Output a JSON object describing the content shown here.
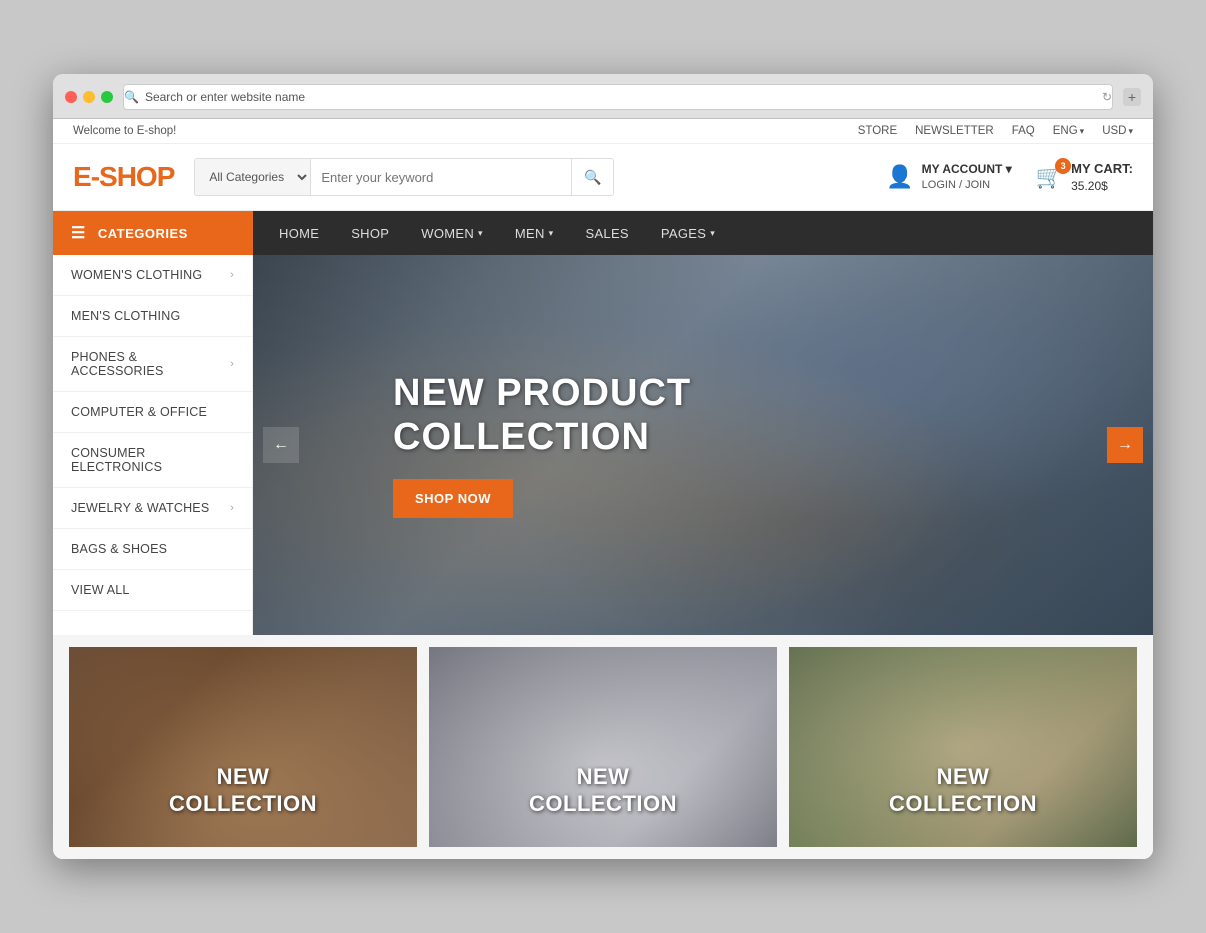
{
  "browser": {
    "address": "Search or enter website name"
  },
  "topbar": {
    "welcome": "Welcome to E-shop!",
    "links": [
      "STORE",
      "NEWSLETTER",
      "FAQ"
    ],
    "lang": "ENG",
    "currency": "USD"
  },
  "header": {
    "logo_prefix": "E",
    "logo_suffix": "-SHOP",
    "search_placeholder": "Enter your keyword",
    "search_category": "All Categories",
    "account_label": "MY ACCOUNT",
    "account_sub": "LOGIN / JOIN",
    "cart_label": "MY CART:",
    "cart_amount": "35.20$",
    "cart_count": "3"
  },
  "navbar": {
    "categories_label": "CATEGORIES",
    "links": [
      {
        "label": "HOME",
        "has_arrow": false
      },
      {
        "label": "SHOP",
        "has_arrow": false
      },
      {
        "label": "WOMEN",
        "has_arrow": true
      },
      {
        "label": "MEN",
        "has_arrow": true
      },
      {
        "label": "SALES",
        "has_arrow": false
      },
      {
        "label": "PAGES",
        "has_arrow": true
      }
    ]
  },
  "sidebar": {
    "items": [
      {
        "label": "WOMEN'S CLOTHING",
        "has_arrow": true
      },
      {
        "label": "MEN'S CLOTHING",
        "has_arrow": false
      },
      {
        "label": "PHONES & ACCESSORIES",
        "has_arrow": true
      },
      {
        "label": "COMPUTER & OFFICE",
        "has_arrow": false
      },
      {
        "label": "CONSUMER ELECTRONICS",
        "has_arrow": false
      },
      {
        "label": "JEWELRY & WATCHES",
        "has_arrow": true
      },
      {
        "label": "BAGS & SHOES",
        "has_arrow": false
      },
      {
        "label": "VIEW ALL",
        "has_arrow": false
      }
    ]
  },
  "hero": {
    "title_line1": "NEW PRODUCT",
    "title_line2": "COLLECTION",
    "cta_label": "SHOP NOW",
    "prev_label": "←",
    "next_label": "→"
  },
  "banners": [
    {
      "title_line1": "NEW",
      "title_line2": "COLLECTION"
    },
    {
      "title_line1": "NEW",
      "title_line2": "COLLECTION"
    },
    {
      "title_line1": "NEW",
      "title_line2": "COLLECTION"
    }
  ]
}
